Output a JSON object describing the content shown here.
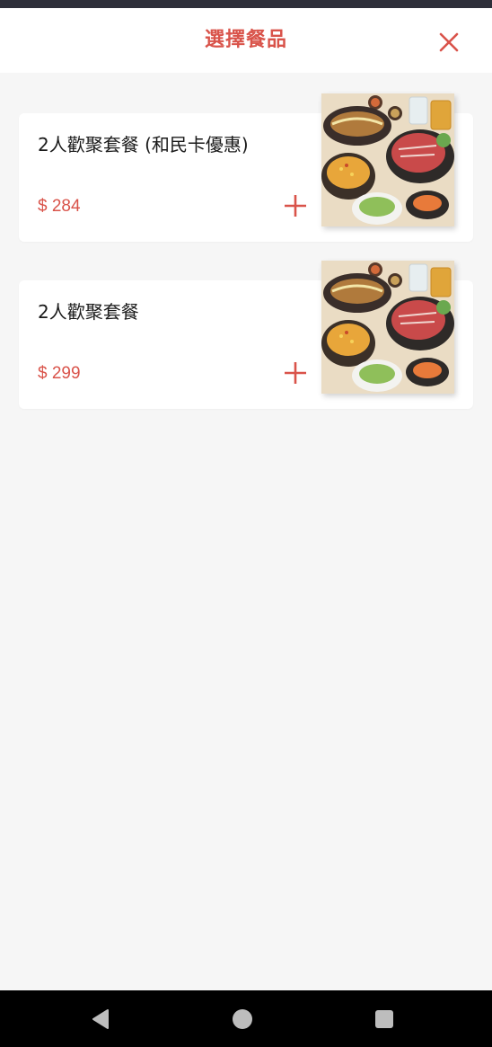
{
  "header": {
    "title": "選擇餐品"
  },
  "accent_color": "#d9534a",
  "items": [
    {
      "name": "2人歡聚套餐 (和民卡優惠)",
      "price": "$ 284",
      "image": "combo-meal-photo"
    },
    {
      "name": "2人歡聚套餐",
      "price": "$ 299",
      "image": "combo-meal-photo"
    }
  ],
  "icons": {
    "close": "close-icon",
    "add": "plus-icon",
    "nav_back": "back-triangle-icon",
    "nav_home": "home-circle-icon",
    "nav_recent": "recent-square-icon"
  }
}
